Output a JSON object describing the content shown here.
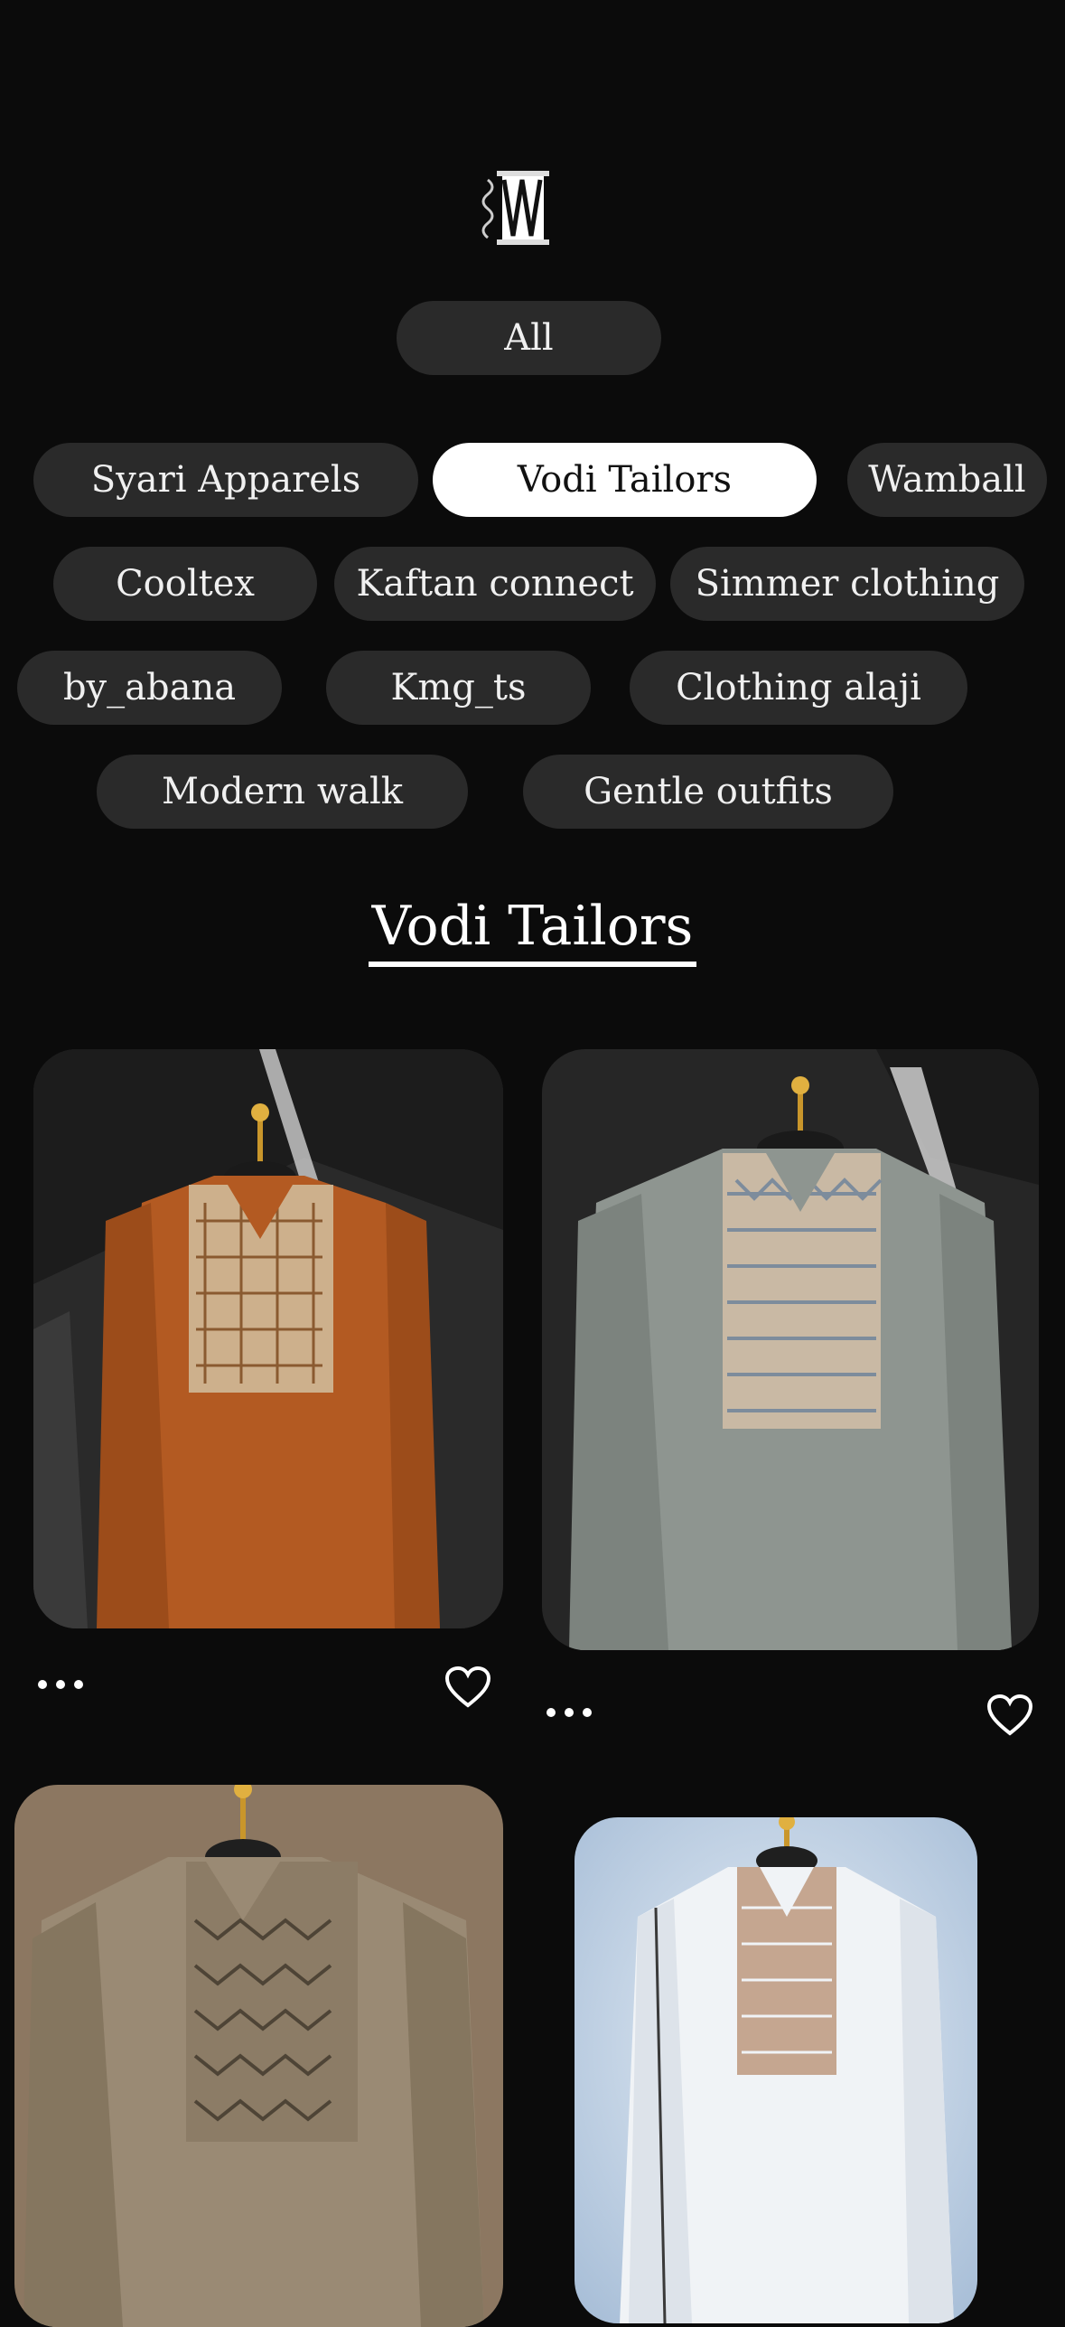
{
  "logo": {
    "icon": "thread-spool-icon"
  },
  "filters": {
    "all_label": "All",
    "vendors": [
      "Syari Apparels",
      "Vodi Tailors",
      "Wamball",
      "Cooltex",
      "Kaftan connect",
      "Simmer clothing",
      "by_abana",
      "Kmg_ts",
      "Clothing alaji",
      "Modern walk",
      "Gentle outfits"
    ],
    "selected": "Vodi Tailors"
  },
  "section": {
    "title": "Vodi Tailors"
  },
  "products": [
    {
      "color": "#b35a22",
      "panel": "#cdb08c",
      "bg": "#2a2a2a",
      "icon_more": "more-dots-icon",
      "icon_like": "heart-outline-icon"
    },
    {
      "color": "#8e9590",
      "panel": "#c9b9a4",
      "bg": "#262626",
      "icon_more": "more-dots-icon",
      "icon_like": "heart-outline-icon"
    },
    {
      "color": "#9a8a74",
      "panel": "#8c7c66",
      "bg": "#8c7761"
    },
    {
      "color": "#f0f3f6",
      "panel": "#c5a690",
      "bg": "#a9bfd8"
    }
  ],
  "colors": {
    "background": "#0b0b0b",
    "chip": "#2a2a2a",
    "chip_active": "#ffffff"
  }
}
